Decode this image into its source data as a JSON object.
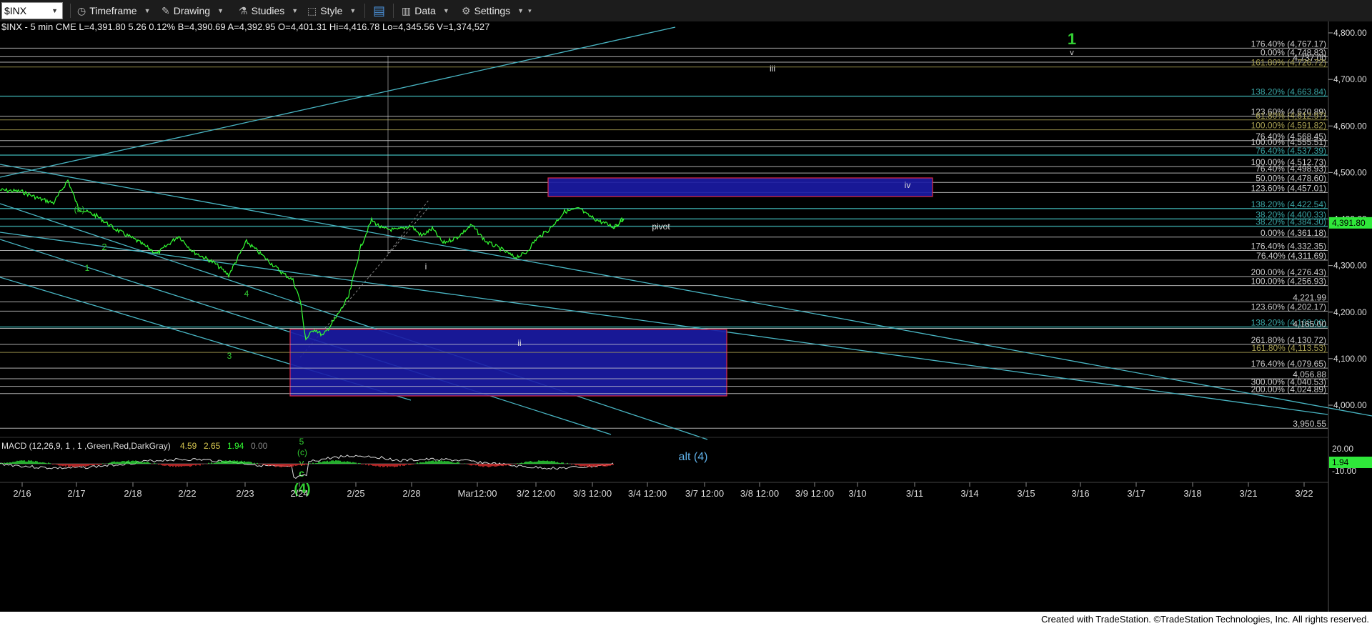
{
  "toolbar": {
    "symbol": "$INX",
    "timeframe": "Timeframe",
    "drawing": "Drawing",
    "studies": "Studies",
    "style": "Style",
    "data": "Data",
    "settings": "Settings"
  },
  "header": {
    "line": "$INX - 5 min  CME  L=4,391.80  5.26  0.12%  B=4,390.69  A=4,392.95  O=4,401.31  Hi=4,416.78  Lo=4,345.56  V=1,374,527"
  },
  "colors": {
    "background": "#000000",
    "price": "#33ff33",
    "wave_green": "#32cd32",
    "trendline": "#49b6c4",
    "fib_white": "#cccccc",
    "fib_olive": "#a8a052",
    "fib_teal": "#3aa6a6",
    "box_fill": "#1b1ba6",
    "box_border": "#e22a4a"
  },
  "price_axis": {
    "ticks": [
      "4,800.00",
      "4,700.00",
      "4,600.00",
      "4,500.00",
      "4,400.00",
      "4,300.00",
      "4,200.00",
      "4,100.00",
      "4,000.00"
    ],
    "last_price": "4,391.80"
  },
  "time_axis": [
    "2/16",
    "2/17",
    "2/18",
    "2/22",
    "2/23",
    "2/24",
    "2/25",
    "2/28",
    "Mar12:00",
    "3/2 12:00",
    "3/3 12:00",
    "3/4 12:00",
    "3/7 12:00",
    "3/8 12:00",
    "3/9 12:00",
    "3/10",
    "3/11",
    "3/14",
    "3/15",
    "3/16",
    "3/17",
    "3/18",
    "3/21",
    "3/22"
  ],
  "fib_labels": [
    {
      "text": "176.40% (4,767.17)",
      "color": "w"
    },
    {
      "text": "0.00% (4,748.83)",
      "color": "w"
    },
    {
      "text": "4,737.00",
      "color": "w"
    },
    {
      "text": "161.80% (4,726.72)",
      "color": "o"
    },
    {
      "text": "138.20% (4,663.84)",
      "color": "t"
    },
    {
      "text": "123.60% (4,620.89)",
      "color": "w"
    },
    {
      "text": "61.80% (4,612.97)",
      "color": "o"
    },
    {
      "text": "100.00% (4,591.82)",
      "color": "o"
    },
    {
      "text": "76.40% (4,568.45)",
      "color": "w"
    },
    {
      "text": "100.00% (4,555.51)",
      "color": "w"
    },
    {
      "text": "76.40% (4,537.39)",
      "color": "t"
    },
    {
      "text": "100.00% (4,512.73)",
      "color": "w"
    },
    {
      "text": "76.40% (4,498.93)",
      "color": "w"
    },
    {
      "text": "50.00% (4,478.60)",
      "color": "w"
    },
    {
      "text": "123.60% (4,457.01)",
      "color": "w"
    },
    {
      "text": "138.20% (4,422.54)",
      "color": "t"
    },
    {
      "text": "38.20% (4,400.33)",
      "color": "t"
    },
    {
      "text": "38.20% (4,384.30)",
      "color": "t"
    },
    {
      "text": "0.00% (4,361.18)",
      "color": "w"
    },
    {
      "text": "176.40% (4,332.35)",
      "color": "w"
    },
    {
      "text": "76.40% (4,311.69)",
      "color": "w"
    },
    {
      "text": "200.00% (4,276.43)",
      "color": "w"
    },
    {
      "text": "100.00% (4,256.93)",
      "color": "w"
    },
    {
      "text": "4,221.99",
      "color": "w"
    },
    {
      "text": "123.60% (4,202.17)",
      "color": "w"
    },
    {
      "text": "138.20% (4,168.00)",
      "color": "t"
    },
    {
      "text": "4,165.00",
      "color": "w"
    },
    {
      "text": "261.80% (4,130.72)",
      "color": "w"
    },
    {
      "text": "161.80% (4,113.53)",
      "color": "o"
    },
    {
      "text": "176.40% (4,079.65)",
      "color": "w"
    },
    {
      "text": "4,056.88",
      "color": "w"
    },
    {
      "text": "300.00% (4,040.53)",
      "color": "w"
    },
    {
      "text": "200.00% (4,024.89)",
      "color": "w"
    },
    {
      "text": "3,950.55",
      "color": "w"
    }
  ],
  "wave_labels": [
    "1",
    "v",
    "iii",
    "iv",
    "pivot",
    "(b)",
    "2",
    "1",
    "4",
    "3",
    "5",
    "(c)",
    "v",
    "c",
    "(4)",
    "i",
    "ii",
    "alt (4)"
  ],
  "macd": {
    "label": "MACD (12,26,9, 1 , 1 ,Green,Red,DarkGray)",
    "values": [
      "4.59",
      "2.65",
      "1.94",
      "0.00"
    ],
    "axis_ticks": [
      "20.00",
      "-10.00"
    ],
    "last": "1.94"
  },
  "footer": "Created with TradeStation. ©TradeStation Technologies, Inc. All rights reserved."
}
